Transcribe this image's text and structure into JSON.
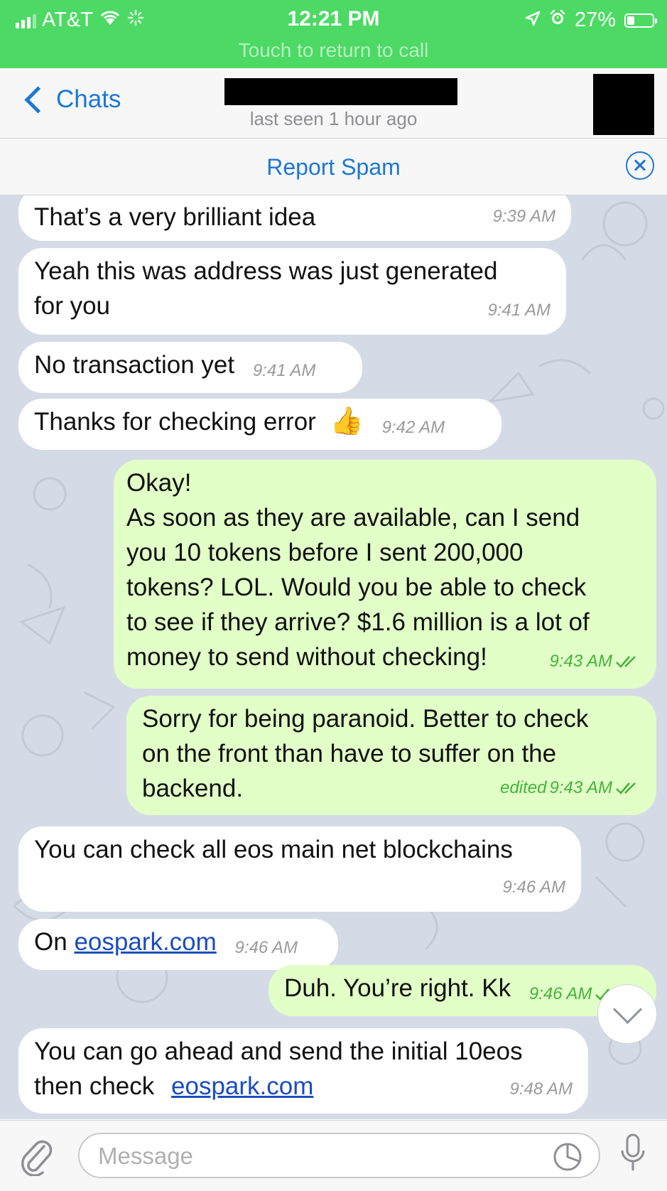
{
  "status_bar": {
    "carrier": "AT&T",
    "time": "12:21 PM",
    "battery": "27%",
    "call_banner": "Touch to return to call"
  },
  "header": {
    "back_label": "Chats",
    "status": "last seen 1 hour ago"
  },
  "spam_bar": {
    "label": "Report Spam"
  },
  "messages": [
    {
      "dir": "in",
      "text": "That’s a very brilliant idea",
      "time": "9:39 AM"
    },
    {
      "dir": "in",
      "text": "Yeah this was address was just generated\nfor you",
      "time": "9:41 AM"
    },
    {
      "dir": "in",
      "text": "No transaction yet",
      "time": "9:41 AM"
    },
    {
      "dir": "in",
      "text": "Thanks for checking error",
      "emoji": "👍",
      "time": "9:42 AM"
    },
    {
      "dir": "out",
      "text": "Okay!\nAs soon as they are available, can I send\nyou 10 tokens before I sent 200,000\ntokens? LOL. Would you be able to check\nto see if they arrive? $1.6 million is a lot of\nmoney to send without checking!",
      "time": "9:43 AM"
    },
    {
      "dir": "out",
      "text": "Sorry for being paranoid. Better to check\non the front than have to suffer on the\nbackend.",
      "edited": "edited",
      "time": "9:43 AM"
    },
    {
      "dir": "in",
      "text": "You can check all eos main net blockchains",
      "time": "9:46 AM"
    },
    {
      "dir": "in",
      "prefix": "On",
      "link": "eospark.com",
      "time": "9:46 AM"
    },
    {
      "dir": "out",
      "text": "Duh. You’re right. Kk",
      "time": "9:46 AM"
    },
    {
      "dir": "in",
      "text": "You can go ahead and send the initial 10eos\nthen check",
      "link": "eospark.com",
      "time": "9:48 AM"
    }
  ],
  "input": {
    "placeholder": "Message"
  },
  "colors": {
    "status_green": "#4cd964",
    "accent_blue": "#1b78d6",
    "outgoing_bubble": "#e1ffc7",
    "incoming_bubble": "#ffffff",
    "wallpaper": "#d4dbe6",
    "read_ticks": "#45b23c"
  },
  "icons": [
    "signal-icon",
    "wifi-icon",
    "activity-icon",
    "location-icon",
    "alarm-icon",
    "battery-icon",
    "back-chevron-icon",
    "close-circle-icon",
    "double-check-icon",
    "scroll-down-icon",
    "paperclip-icon",
    "sticker-icon",
    "microphone-icon"
  ]
}
